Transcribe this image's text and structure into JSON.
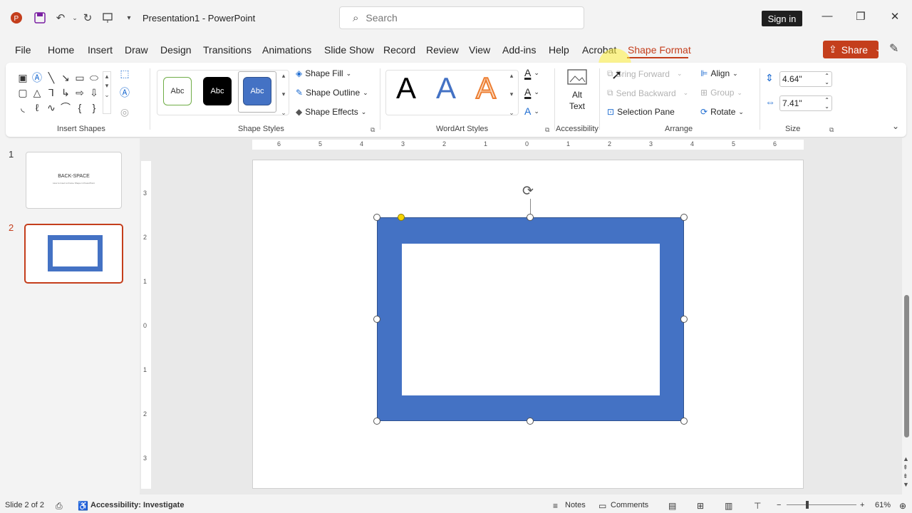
{
  "app": {
    "title": "Presentation1  -  PowerPoint",
    "search_placeholder": "Search",
    "sign_in": "Sign in",
    "share": "Share"
  },
  "tabs": [
    "File",
    "Home",
    "Insert",
    "Draw",
    "Design",
    "Transitions",
    "Animations",
    "Slide Show",
    "Record",
    "Review",
    "View",
    "Add-ins",
    "Help",
    "Acrobat",
    "Shape Format"
  ],
  "active_tab": "Shape Format",
  "ribbon": {
    "insert_shapes_label": "Insert Shapes",
    "shape_styles_label": "Shape Styles",
    "style_sample": "Abc",
    "shape_fill": "Shape Fill",
    "shape_outline": "Shape Outline",
    "shape_effects": "Shape Effects",
    "wordart_label": "WordArt Styles",
    "wordart_sample": "A",
    "alt_text_line1": "Alt",
    "alt_text_line2": "Text",
    "accessibility_label": "Accessibility",
    "bring_forward": "Bring Forward",
    "send_backward": "Send Backward",
    "selection_pane": "Selection Pane",
    "align": "Align",
    "group": "Group",
    "rotate": "Rotate",
    "arrange_label": "Arrange",
    "height_value": "4.64\"",
    "width_value": "7.41\"",
    "size_label": "Size"
  },
  "slides": [
    {
      "number": "1",
      "title": "BACK-SPACE",
      "subtitle": "How to Insert a Frame Shape in PowerPoint"
    },
    {
      "number": "2"
    }
  ],
  "ruler": {
    "h": [
      "6",
      "5",
      "4",
      "3",
      "2",
      "1",
      "0",
      "1",
      "2",
      "3",
      "4",
      "5",
      "6"
    ],
    "v": [
      "3",
      "2",
      "1",
      "0",
      "1",
      "2",
      "3"
    ]
  },
  "status": {
    "slide": "Slide 2 of 2",
    "accessibility": "Accessibility: Investigate",
    "notes": "Notes",
    "comments": "Comments",
    "zoom": "61%"
  },
  "colors": {
    "accent": "#c43e1c",
    "frame": "#4472c4"
  }
}
